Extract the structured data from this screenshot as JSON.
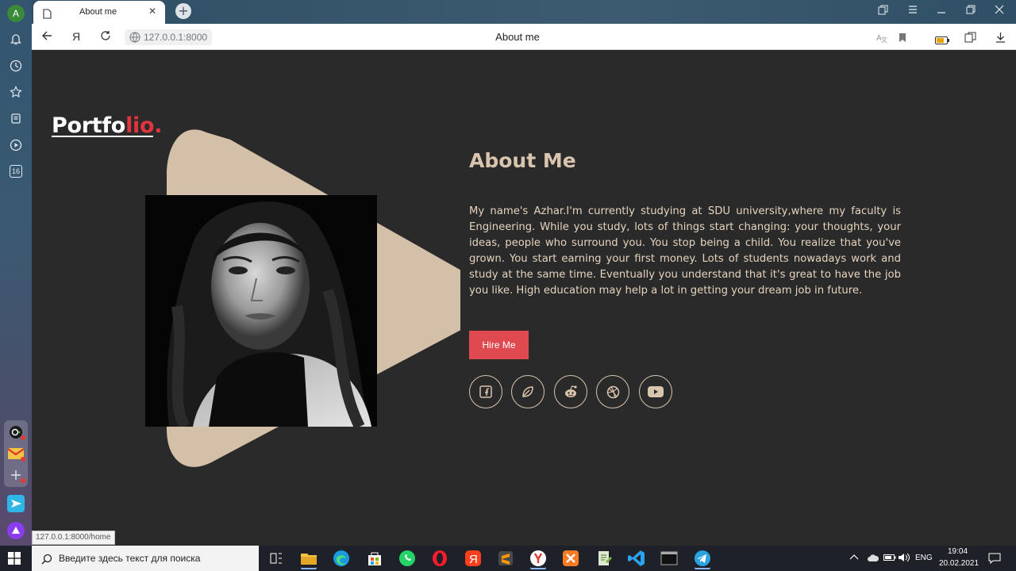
{
  "sidebar": {
    "avatar_letter": "A",
    "badge_count": "16"
  },
  "browser": {
    "tab_title": "About me",
    "url": "127.0.0.1:8000",
    "page_title": "About me",
    "status_url": "127.0.0.1:8000/home"
  },
  "page": {
    "logo_main": "Portfo",
    "logo_accent": "lio.",
    "about_title": "About Me",
    "about_text": "My name's Azhar.I'm currently studying at SDU university,where my faculty is Engineering. While you study, lots of things start changing: your thoughts, your ideas, people who surround you. You stop being a child. You realize that you've grown. You start earning your first money. Lots of students nowadays work and study at the same time. Eventually you understand that it's great to have the job you like. High education may help a lot in getting your dream job in future.",
    "hire_label": "Hire Me",
    "social_icons": [
      "facebook-icon",
      "leaf-icon",
      "reddit-icon",
      "dribbble-icon",
      "youtube-icon"
    ],
    "colors": {
      "accent": "#e0343f",
      "beige": "#d9c4ae",
      "button": "#de4a4f",
      "background": "#2a2a2a"
    }
  },
  "taskbar": {
    "search_placeholder": "Введите здесь текст для поиска",
    "language": "ENG",
    "time": "19:04",
    "date": "20.02.2021"
  }
}
